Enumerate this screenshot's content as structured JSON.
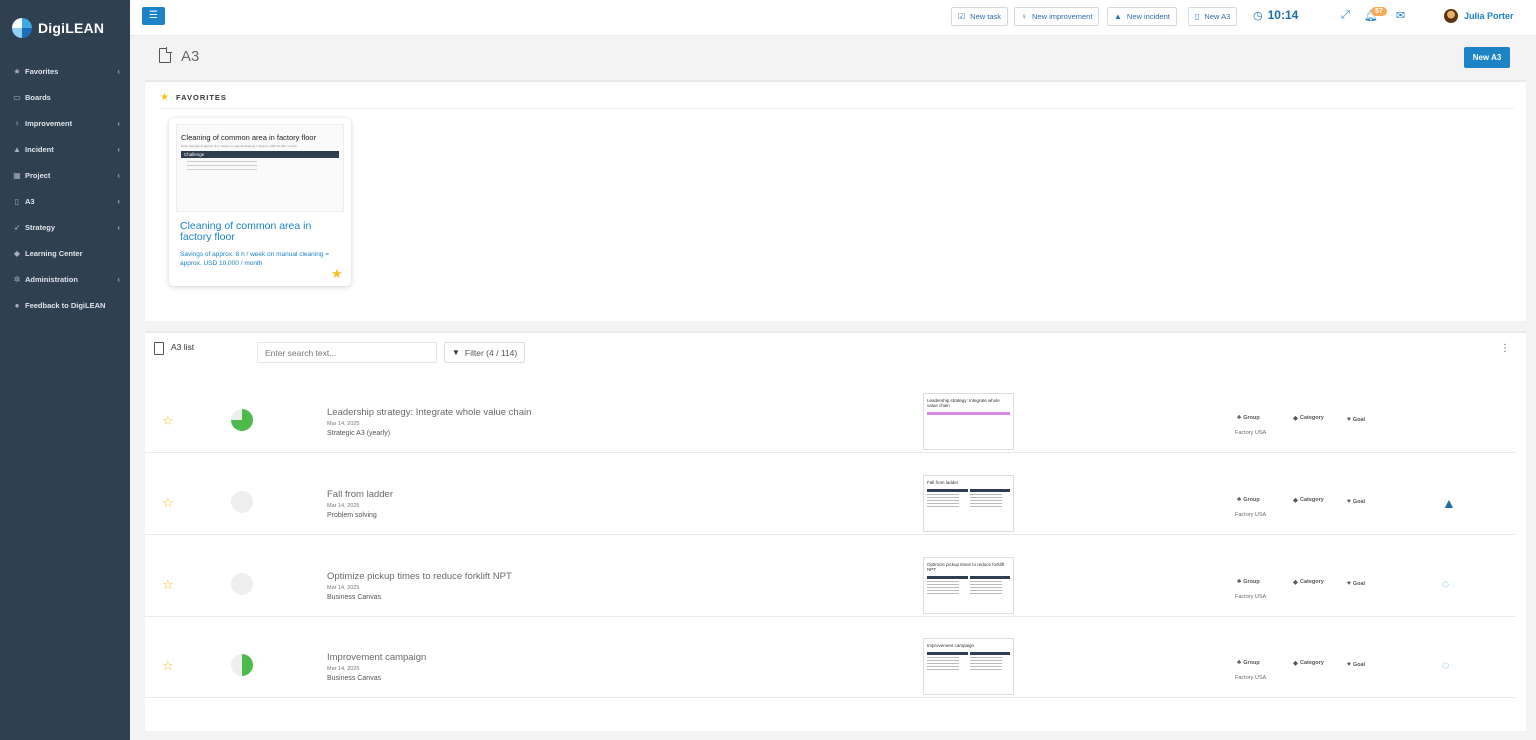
{
  "app": {
    "name": "DigiLEAN"
  },
  "sidebar": {
    "items": [
      {
        "label": "Favorites",
        "icon": "star-icon",
        "glyph": "★",
        "has_submenu": true
      },
      {
        "label": "Boards",
        "icon": "monitor-icon",
        "glyph": "▭",
        "has_submenu": false
      },
      {
        "label": "Improvement",
        "icon": "lightbulb-icon",
        "glyph": "♀",
        "has_submenu": true
      },
      {
        "label": "Incident",
        "icon": "warning-icon",
        "glyph": "▲",
        "has_submenu": true
      },
      {
        "label": "Project",
        "icon": "calendar-icon",
        "glyph": "▦",
        "has_submenu": true
      },
      {
        "label": "A3",
        "icon": "document-icon",
        "glyph": "▯",
        "has_submenu": true
      },
      {
        "label": "Strategy",
        "icon": "rocket-icon",
        "glyph": "➶",
        "has_submenu": true
      },
      {
        "label": "Learning Center",
        "icon": "graduation-cap-icon",
        "glyph": "◆",
        "has_submenu": false
      },
      {
        "label": "Administration",
        "icon": "gears-icon",
        "glyph": "✲",
        "has_submenu": true
      },
      {
        "label": "Feedback to DigiLEAN",
        "icon": "comment-icon",
        "glyph": "●",
        "has_submenu": false
      }
    ]
  },
  "topbar": {
    "buttons": [
      {
        "label": "New task",
        "icon": "checkbox-icon",
        "glyph": "☑"
      },
      {
        "label": "New improvement",
        "icon": "lightbulb-icon",
        "glyph": "♀"
      },
      {
        "label": "New incident",
        "icon": "warning-icon",
        "glyph": "▲"
      },
      {
        "label": "New A3",
        "icon": "document-icon",
        "glyph": "▯"
      }
    ],
    "time": "10:14",
    "notification_count": "57",
    "user_name": "Julia Porter"
  },
  "page": {
    "title": "A3",
    "new_button": "New A3"
  },
  "favorites": {
    "heading": "FAVORITES",
    "card": {
      "thumb_title": "Cleaning of common area in factory floor",
      "thumb_sub": "Goal: Savings of approx. 8 h / week on manual cleaning = approx. USD 10,000 / month",
      "thumb_section": "Challenge",
      "title": "Cleaning of common area in factory floor",
      "description": "Savings of approx. 8 h / week on manual cleaning = approx. USD 10,000 / month"
    }
  },
  "a3list": {
    "title": "A3 list",
    "search_placeholder": "Enter search text...",
    "filter_label": "Filter (4 / 114)",
    "labels": {
      "group": "Group",
      "category": "Category",
      "goal": "Goal"
    },
    "rows": [
      {
        "title": "Leadership strategy: Integrate whole value chain",
        "date": "Mar 14, 2025",
        "type": "Strategic A3 (yearly)",
        "progress": 0.75,
        "group_value": "Factory USA",
        "thumb_title": "Leadership strategy: Integrate whole value chain",
        "thumb_style": "purple",
        "status_icon": ""
      },
      {
        "title": "Fall from ladder",
        "date": "Mar 14, 2025",
        "type": "Problem solving",
        "progress": 0,
        "group_value": "Factory USA",
        "thumb_title": "Fall from ladder",
        "thumb_style": "two-col",
        "status_icon": "warning-icon"
      },
      {
        "title": "Optimize pickup times to reduce forklift NPT",
        "date": "Mar 14, 2025",
        "type": "Business Canvas",
        "progress": 0,
        "group_value": "Factory USA",
        "thumb_title": "Optimize pickup times to reduce forklift NPT",
        "thumb_style": "two-col",
        "status_icon": "lightbulb-icon"
      },
      {
        "title": "Improvement campaign",
        "date": "Mar 14, 2025",
        "type": "Business Canvas",
        "progress": 0.5,
        "group_value": "Factory USA",
        "thumb_title": "Improvement campaign",
        "thumb_style": "two-col",
        "status_icon": "lightbulb-icon"
      }
    ]
  },
  "colors": {
    "sidebar_bg": "#2f4050",
    "primary": "#1c84c6",
    "star": "#f5c21b",
    "progress": "#4cbb4c",
    "badge": "#f8ac59"
  }
}
